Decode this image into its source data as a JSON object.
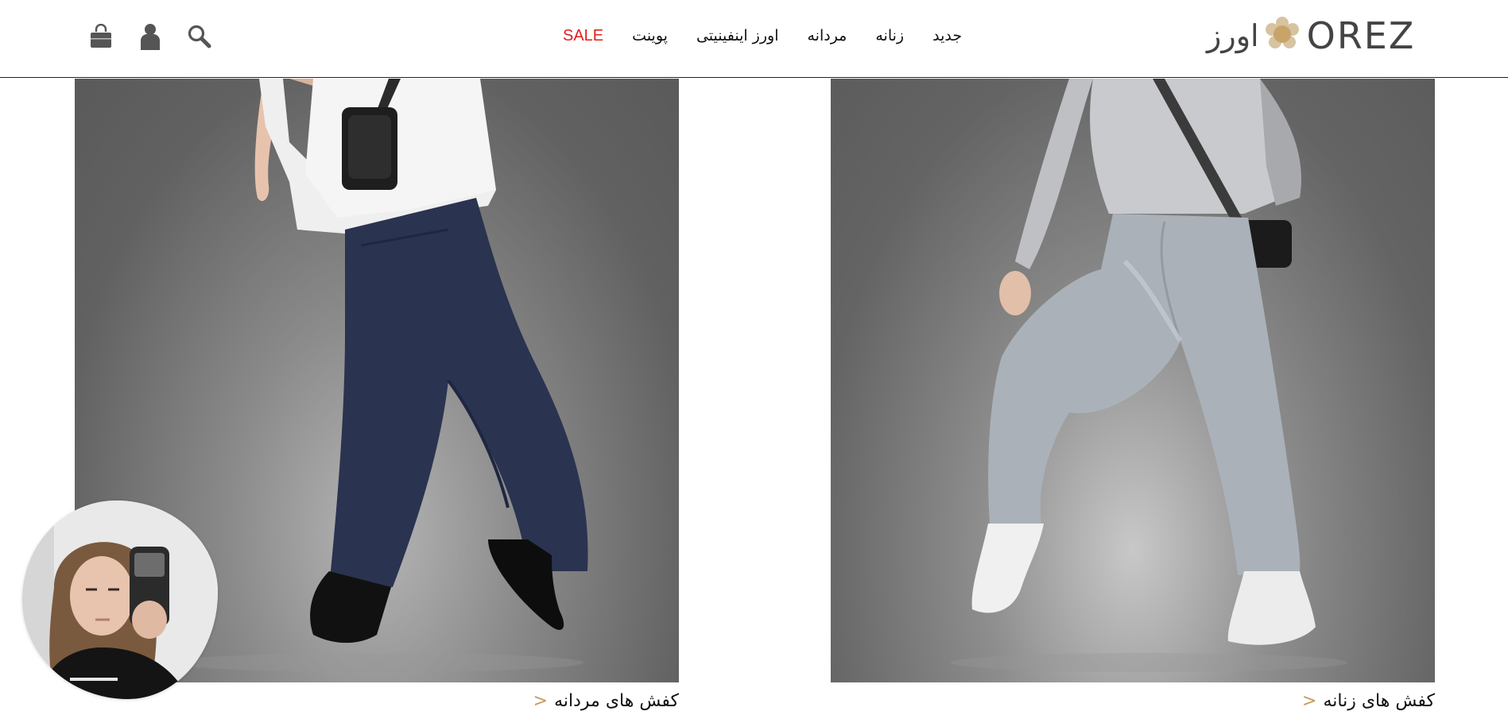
{
  "header": {
    "logo": {
      "text_en": "OREZ",
      "text_fa": "اورز",
      "icon": "flower-logo-icon"
    },
    "nav": [
      {
        "label": "جدید",
        "id": "new"
      },
      {
        "label": "زنانه",
        "id": "women"
      },
      {
        "label": "مردانه",
        "id": "men"
      },
      {
        "label": "اورز اینفینیتی",
        "id": "orez-infinity"
      },
      {
        "label": "پوینت",
        "id": "point"
      },
      {
        "label": "SALE",
        "id": "sale"
      }
    ],
    "icons": [
      "shopping-bag-icon",
      "user-icon",
      "search-icon"
    ]
  },
  "panels": {
    "men": {
      "caption": "کفش های مردانه",
      "chevron": "<"
    },
    "women": {
      "caption": "کفش های زنانه",
      "chevron": "<"
    }
  },
  "colors": {
    "sale": "#e21e1e",
    "accent": "#c99a5b",
    "logo": "#444444"
  }
}
